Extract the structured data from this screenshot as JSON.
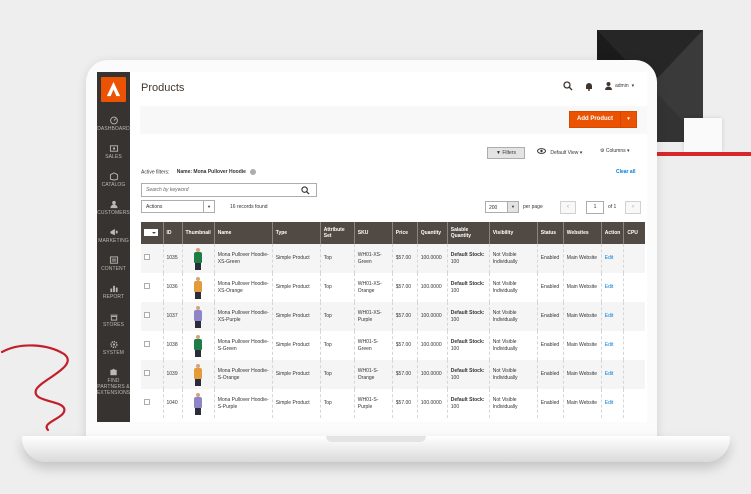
{
  "sidebar": {
    "items": [
      {
        "label": "DASHBOARD",
        "icon": "dashboard-icon"
      },
      {
        "label": "SALES",
        "icon": "dollar-icon"
      },
      {
        "label": "CATALOG",
        "icon": "box-icon"
      },
      {
        "label": "CUSTOMERS",
        "icon": "customers-icon"
      },
      {
        "label": "MARKETING",
        "icon": "megaphone-icon"
      },
      {
        "label": "CONTENT",
        "icon": "content-icon"
      },
      {
        "label": "REPORT",
        "icon": "bar-chart-icon"
      },
      {
        "label": "STORES",
        "icon": "store-icon"
      },
      {
        "label": "SYSTEM",
        "icon": "gear-icon"
      },
      {
        "label": "FIND PARTNERS & EXTENSIONS",
        "icon": "puzzle-icon"
      }
    ]
  },
  "header": {
    "title": "Products",
    "user": "admin"
  },
  "toolbar": {
    "add_product": "Add Product",
    "filters": "Filters",
    "default_view": "Default View",
    "columns": "Columns"
  },
  "filters": {
    "label": "Active filters:",
    "active": "Name: Mona Pullover Hoodie",
    "clear_all": "Clear all"
  },
  "search": {
    "placeholder": "Search by keyword"
  },
  "mass_actions": {
    "label": "Actions",
    "records": "16 records found"
  },
  "pagination": {
    "per_page": "200",
    "per_page_label": "per page",
    "page": "1",
    "of": "of 1"
  },
  "grid": {
    "columns": [
      "ID",
      "Thumbnail",
      "Name",
      "Type",
      "Attribute Set",
      "SKU",
      "Price",
      "Quantity",
      "Salable Quantity",
      "Visibility",
      "Status",
      "Websites",
      "Action",
      "CPU"
    ],
    "rows": [
      {
        "id": "1035",
        "color": "#1d7d45",
        "name": "Mona Pullover Hoodie-XS-Green",
        "type": "Simple Product",
        "set": "Top",
        "sku": "WH01-XS-Green",
        "price": "$57.00",
        "qty": "100.0000",
        "salable_label": "Default Stock:",
        "salable_val": "100",
        "visibility": "Not Visible Individually",
        "status": "Enabled",
        "websites": "Main Website",
        "action": "Edit"
      },
      {
        "id": "1036",
        "color": "#e49b3c",
        "name": "Mona Pullover Hoodie-XS-Orange",
        "type": "Simple Product",
        "set": "Top",
        "sku": "WH01-XS-Orange",
        "price": "$57.00",
        "qty": "100.0000",
        "salable_label": "Default Stock:",
        "salable_val": "100",
        "visibility": "Not Visible Individually",
        "status": "Enabled",
        "websites": "Main Website",
        "action": "Edit"
      },
      {
        "id": "1037",
        "color": "#8e85c9",
        "name": "Mona Pullover Hoodie-XS-Purple",
        "type": "Simple Product",
        "set": "Top",
        "sku": "WH01-XS-Purple",
        "price": "$57.00",
        "qty": "100.0000",
        "salable_label": "Default Stock:",
        "salable_val": "100",
        "visibility": "Not Visible Individually",
        "status": "Enabled",
        "websites": "Main Website",
        "action": "Edit"
      },
      {
        "id": "1038",
        "color": "#1d7d45",
        "name": "Mona Pullover Hoodie-S-Green",
        "type": "Simple Product",
        "set": "Top",
        "sku": "WH01-S-Green",
        "price": "$57.00",
        "qty": "100.0000",
        "salable_label": "Default Stock:",
        "salable_val": "100",
        "visibility": "Not Visible Individually",
        "status": "Enabled",
        "websites": "Main Website",
        "action": "Edit"
      },
      {
        "id": "1039",
        "color": "#e49b3c",
        "name": "Mona Pullover Hoodie-S-Orange",
        "type": "Simple Product",
        "set": "Top",
        "sku": "WH01-S-Orange",
        "price": "$57.00",
        "qty": "100.0000",
        "salable_label": "Default Stock:",
        "salable_val": "100",
        "visibility": "Not Visible Individually",
        "status": "Enabled",
        "websites": "Main Website",
        "action": "Edit"
      },
      {
        "id": "1040",
        "color": "#8e85c9",
        "name": "Mona Pullover Hoodie-S-Purple",
        "type": "Simple Product",
        "set": "Top",
        "sku": "WH01-S-Purple",
        "price": "$57.00",
        "qty": "100.0000",
        "salable_label": "Default Stock:",
        "salable_val": "100",
        "visibility": "Not Visible Individually",
        "status": "Enabled",
        "websites": "Main Website",
        "action": "Edit"
      }
    ]
  },
  "colors": {
    "accent": "#eb5202",
    "sidebar": "#373330",
    "grid_header": "#514943",
    "link": "#007bdb",
    "decor_red": "#d8272b"
  }
}
